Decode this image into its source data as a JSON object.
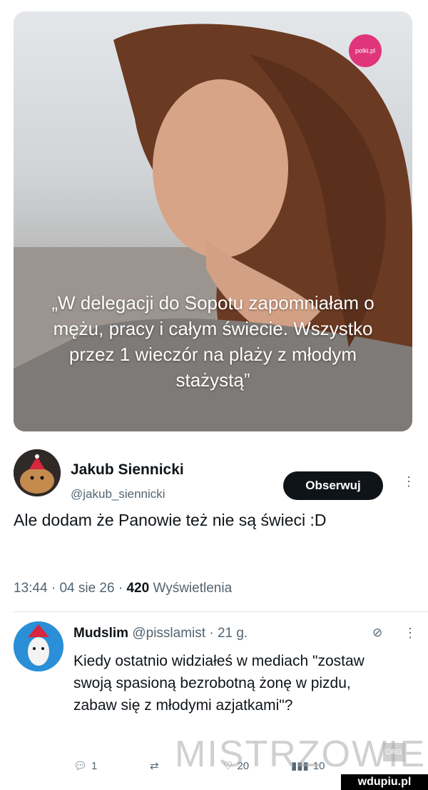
{
  "image": {
    "source_badge": "polki.pl",
    "quote": "„W delegacji do Sopotu zapomniałam o mężu, pracy i całym świecie. Wszystko przez 1 wieczór na plaży z młodym stażystą”"
  },
  "tweet": {
    "author_name": "Jakub Siennicki",
    "author_handle": "@jakub_siennicki",
    "follow_label": "Obserwuj",
    "text": "Ale dodam że Panowie też nie są świeci :D",
    "time": "13:44",
    "date": "04 sie 26",
    "views_count": "420",
    "views_label": "Wyświetlenia",
    "sep": "·"
  },
  "reply": {
    "author_name": "Mudslim",
    "author_handle": "@pisslamist",
    "age": "21 g.",
    "text": "Kiedy ostatnio widziałeś w mediach \"zostaw swoją spasioną bezrobotną żonę w pizdu, zabaw się z młodymi azjatkami\"?",
    "reply_count": "1",
    "like_count": "20",
    "views_count": "10"
  },
  "watermark": {
    "text": "MISTRZOWIE",
    "org": "ORG",
    "site": "wdupiu.pl"
  },
  "icons": {
    "reply": "reply-icon",
    "retweet": "retweet-icon",
    "like": "heart-icon",
    "views": "views-icon",
    "grok": "grok-icon",
    "more": "more-dots-icon"
  }
}
